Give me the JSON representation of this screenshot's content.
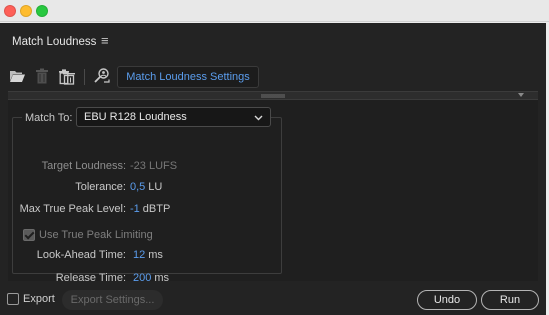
{
  "panel": {
    "title": "Match Loudness",
    "menu_glyph": "≡"
  },
  "toolbar": {
    "icons": [
      "folder-open-icon",
      "trash-icon",
      "trash-all-icon",
      "search-person-icon"
    ],
    "active_tab": "Match Loudness Settings"
  },
  "settings": {
    "match_to_label": "Match To:",
    "match_to_value": "EBU R128 Loudness",
    "target_loudness": {
      "label": "Target Loudness:",
      "value": "-23 LUFS"
    },
    "tolerance": {
      "label": "Tolerance:",
      "value": "0,5",
      "unit": "LU"
    },
    "max_true_peak": {
      "label": "Max True Peak Level:",
      "value": "-1",
      "unit": "dBTP"
    },
    "use_true_peak": {
      "label": "Use True Peak Limiting",
      "checked": true
    },
    "look_ahead": {
      "label": "Look-Ahead Time:",
      "value": "12",
      "unit": "ms"
    },
    "release": {
      "label": "Release Time:",
      "value": "200",
      "unit": "ms"
    }
  },
  "footer": {
    "export_label": "Export",
    "export_checked": false,
    "export_settings_label": "Export Settings...",
    "undo_label": "Undo",
    "run_label": "Run"
  },
  "colors": {
    "accent": "#5b9ded",
    "panel_bg": "#232323",
    "content_bg": "#1f1f1f"
  }
}
